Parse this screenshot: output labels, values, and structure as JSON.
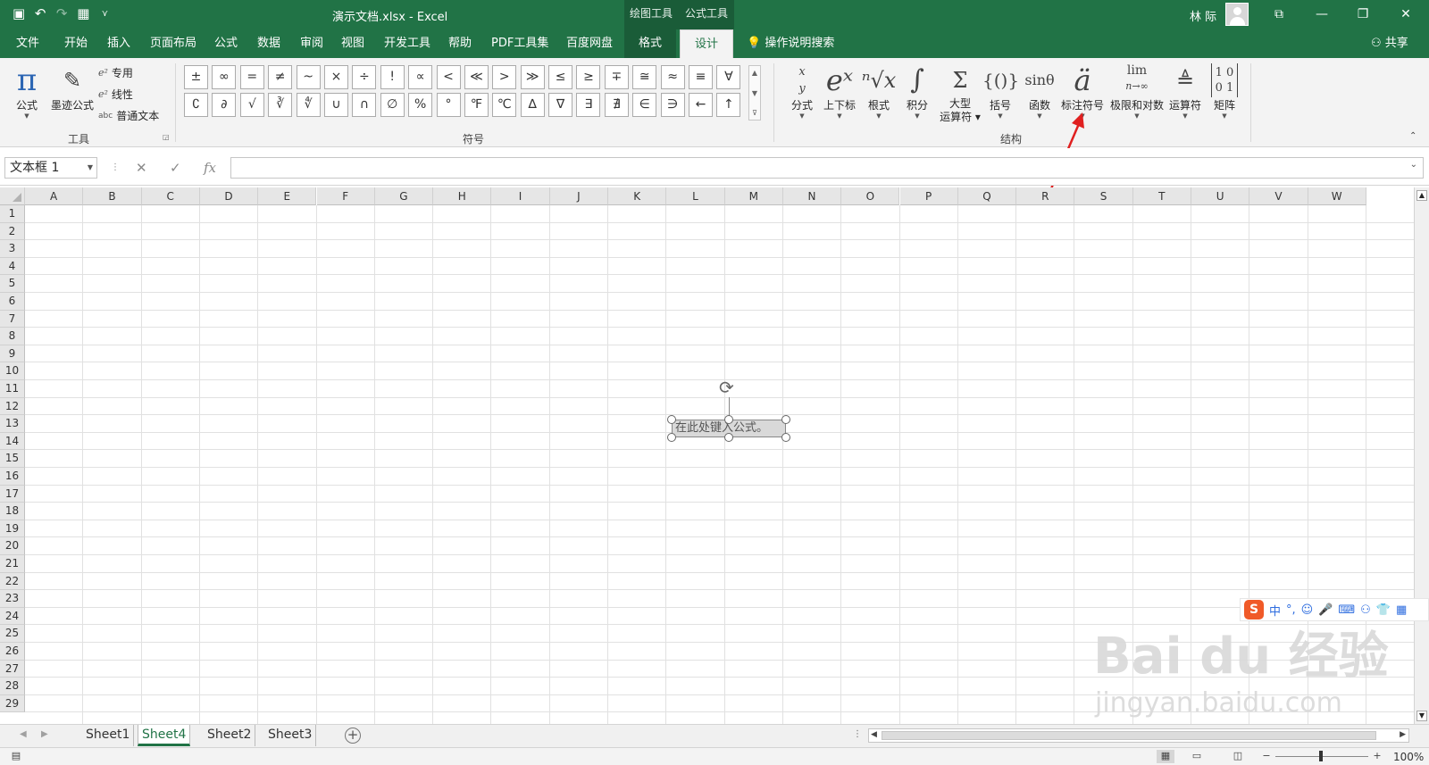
{
  "title_bar": {
    "doc_title": "演示文档.xlsx  -  Excel",
    "ctx_draw": "绘图工具",
    "ctx_formula": "公式工具",
    "user_name": "林 际",
    "qat_undo": "↶",
    "qat_redo": "↷",
    "qat_save": "💾",
    "qat_calc": "▦",
    "qat_more": "⋎"
  },
  "tabs": [
    "文件",
    "开始",
    "插入",
    "页面布局",
    "公式",
    "数据",
    "审阅",
    "视图",
    "开发工具",
    "帮助",
    "PDF工具集",
    "百度网盘",
    "格式",
    "设计"
  ],
  "tell_me": "操作说明搜索",
  "share": "共享",
  "ribbon": {
    "tools": {
      "label": "工具",
      "formula": "公式",
      "ink": "墨迹公式",
      "professional": "专用",
      "linear": "线性",
      "normal_text": "普通文本",
      "abc": "abc"
    },
    "symbols": {
      "label": "符号",
      "row1": [
        "±",
        "∞",
        "=",
        "≠",
        "~",
        "×",
        "÷",
        "!",
        "∝",
        "<",
        "≪",
        ">",
        "≫",
        "≤",
        "≥",
        "∓",
        "≅",
        "≈",
        "≡",
        "∀"
      ],
      "row2": [
        "∁",
        "∂",
        "√",
        "∛",
        "∜",
        "∪",
        "∩",
        "∅",
        "%",
        "°",
        "℉",
        "℃",
        "∆",
        "∇",
        "∃",
        "∄",
        "∈",
        "∋",
        "←",
        "↑"
      ]
    },
    "structures": {
      "label": "结构",
      "items": [
        {
          "glyph": "x/y",
          "label": "分式"
        },
        {
          "glyph": "eˣ",
          "label": "上下标"
        },
        {
          "glyph": "ⁿ√x",
          "label": "根式"
        },
        {
          "glyph": "∫",
          "label": "积分"
        },
        {
          "glyph": "Σ",
          "label": "大型\n运算符"
        },
        {
          "glyph": "{()}",
          "label": "括号"
        },
        {
          "glyph": "sinθ",
          "label": "函数"
        },
        {
          "glyph": "ä",
          "label": "标注符号"
        },
        {
          "glyph": "lim",
          "label": "极限和对数"
        },
        {
          "glyph": "△",
          "label": "运算符"
        },
        {
          "glyph": "[10;01]",
          "label": "矩阵"
        }
      ]
    }
  },
  "formula_bar": {
    "name_box": "文本框 1",
    "cancel": "✕",
    "enter": "✓",
    "fx": "fx",
    "value": ""
  },
  "grid": {
    "columns": [
      "A",
      "B",
      "C",
      "D",
      "E",
      "F",
      "G",
      "H",
      "I",
      "J",
      "K",
      "L",
      "M",
      "N",
      "O",
      "P",
      "Q",
      "R",
      "S",
      "T",
      "U",
      "V",
      "W"
    ],
    "rows": [
      "1",
      "2",
      "3",
      "4",
      "5",
      "6",
      "7",
      "8",
      "9",
      "10",
      "11",
      "12",
      "13",
      "14",
      "15",
      "16",
      "17",
      "18",
      "19",
      "20",
      "21",
      "22",
      "23",
      "24",
      "25",
      "26",
      "27",
      "28",
      "29"
    ]
  },
  "textbox": {
    "placeholder": "在此处键入公式。"
  },
  "sheets": [
    {
      "name": "Sheet1",
      "active": false
    },
    {
      "name": "Sheet4",
      "active": true
    },
    {
      "name": "Sheet2",
      "active": false
    },
    {
      "name": "Sheet3",
      "active": false
    }
  ],
  "status": {
    "zoom": "100%",
    "zoom_minus": "−",
    "zoom_plus": "+"
  },
  "ime": {
    "lang": "中",
    "punct": "°,"
  },
  "watermark": {
    "brand": "Bai du 经验",
    "url": "jingyan.baidu.com"
  },
  "colors": {
    "excel_green": "#217346",
    "annotation_red": "#e02020"
  }
}
